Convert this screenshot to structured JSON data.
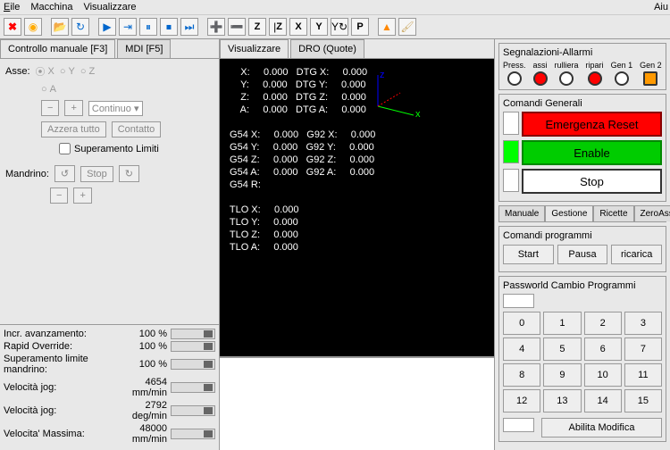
{
  "menu": {
    "file": "Eile",
    "macchina": "Macchina",
    "visualizzare": "Visualizzare",
    "aiuto": "Aiu"
  },
  "leftTabs": {
    "t1": "Controllo manuale [F3]",
    "t2": "MDI [F5]"
  },
  "axes": {
    "label": "Asse:",
    "x": "X",
    "y": "Y",
    "z": "Z",
    "a": "A"
  },
  "jog": {
    "continuo": "Continuo",
    "azzera": "Azzera tutto",
    "contatto": "Contatto",
    "limiti": "Superamento Limiti"
  },
  "mandrino": {
    "label": "Mandrino:",
    "stop": "Stop"
  },
  "overrides": {
    "r1": {
      "lbl": "Incr. avanzamento:",
      "val": "100 %"
    },
    "r2": {
      "lbl": "Rapid Override:",
      "val": "100 %"
    },
    "r3": {
      "lbl": "Superamento limite mandrino:",
      "val": "100 %"
    },
    "r4": {
      "lbl": "Velocità jog:",
      "val": "4654 mm/min"
    },
    "r5": {
      "lbl": "Velocità jog:",
      "val": "2792 deg/min"
    },
    "r6": {
      "lbl": "Velocita' Massima:",
      "val": "48000 mm/min"
    }
  },
  "centerTabs": {
    "t1": "Visualizzare",
    "t2": "DRO (Quote)"
  },
  "dro": "     X:     0.000   DTG X:     0.000\n     Y:     0.000   DTG Y:     0.000\n     Z:     0.000   DTG Z:     0.000\n     A:     0.000   DTG A:     0.000\n\n G54 X:     0.000   G92 X:     0.000\n G54 Y:     0.000   G92 Y:     0.000\n G54 Z:     0.000   G92 Z:     0.000\n G54 A:     0.000   G92 A:     0.000\n G54 R:\n\n TLO X:     0.000\n TLO Y:     0.000\n TLO Z:     0.000\n TLO A:     0.000",
  "alarms": {
    "title": "Segnalazioni-Allarmi",
    "l1": "Press.",
    "l2": "assi",
    "l3": "rulliera",
    "l4": "ripari",
    "l5": "Gen 1",
    "l6": "Gen 2"
  },
  "comandi": {
    "title": "Comandi Generali",
    "b1": "Emergenza Reset",
    "b2": "Enable",
    "b3": "Stop"
  },
  "rtabs": {
    "t1": "Manuale",
    "t2": "Gestione",
    "t3": "Ricette",
    "t4": "ZeroAssi"
  },
  "prog": {
    "title": "Comandi programmi",
    "b1": "Start",
    "b2": "Pausa",
    "b3": "ricarica"
  },
  "pw": {
    "title": "Passworld Cambio Programmi",
    "btn": "Abilita Modifica"
  },
  "keys": [
    "0",
    "1",
    "2",
    "3",
    "4",
    "5",
    "6",
    "7",
    "8",
    "9",
    "10",
    "11",
    "12",
    "13",
    "14",
    "15"
  ]
}
